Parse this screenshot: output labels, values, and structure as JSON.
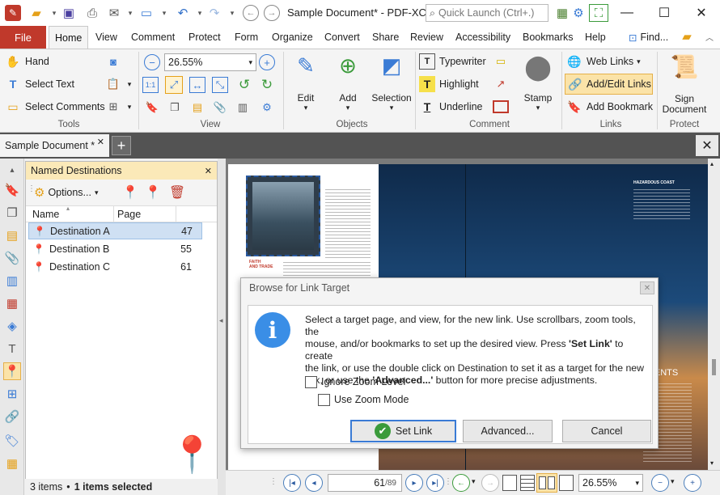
{
  "window": {
    "title": "Sample Document* - PDF-XCh...",
    "quick_launch_placeholder": "Quick Launch (Ctrl+.)"
  },
  "ribbon_tabs": [
    "File",
    "Home",
    "View",
    "Comment",
    "Protect",
    "Form",
    "Organize",
    "Convert",
    "Share",
    "Review",
    "Accessibility",
    "Bookmarks",
    "Help"
  ],
  "find_label": "Find...",
  "tools_group": {
    "hand": "Hand",
    "select_text": "Select Text",
    "select_comments": "Select Comments",
    "label": "Tools"
  },
  "view_group": {
    "zoom": "26.55%",
    "label": "View"
  },
  "objects_group": {
    "edit": "Edit",
    "add": "Add",
    "selection": "Selection",
    "label": "Objects"
  },
  "comment_group": {
    "typewriter": "Typewriter",
    "highlight": "Highlight",
    "underline": "Underline",
    "stamp": "Stamp",
    "label": "Comment"
  },
  "links_group": {
    "web_links": "Web Links",
    "add_edit_links": "Add/Edit Links",
    "add_bookmark": "Add Bookmark",
    "label": "Links"
  },
  "protect_group": {
    "sign_document_line1": "Sign",
    "sign_document_line2": "Document",
    "label": "Protect"
  },
  "doc_tab": "Sample Document *",
  "panel": {
    "title": "Named Destinations",
    "options": "Options...",
    "col_name": "Name",
    "col_page": "Page",
    "rows": [
      {
        "name": "Destination A",
        "page": "47"
      },
      {
        "name": "Destination B",
        "page": "55"
      },
      {
        "name": "Destination C",
        "page": "61"
      }
    ],
    "status_items": "3 items",
    "status_selected": "1 items selected"
  },
  "page_text": {
    "article_heading": "HAZARDOUS COAST",
    "faith_line1": "FAITH",
    "faith_line2": "AND TRADE",
    "right_heading": "DCENTS"
  },
  "dialog": {
    "title": "Browse for Link Target",
    "msg_line1": "Select a target page, and view, for the new link. Use scrollbars, zoom tools, the",
    "msg_line2_pre": "mouse, and/or bookmarks to set up the desired view. Press ",
    "msg_line2_bold": "'Set Link'",
    "msg_line2_post": " to create",
    "msg_line3": "the link, or use the double click on Destination to set it as a target for the new",
    "msg_line4_pre": "link, or use the ",
    "msg_line4_bold": "'Advanced...'",
    "msg_line4_post": " button for more precise adjustments.",
    "ignore_zoom": "Ignore Zoom Level",
    "use_zoom_mode": "Use Zoom Mode",
    "set_link": "Set Link",
    "advanced": "Advanced...",
    "cancel": "Cancel"
  },
  "navigation": {
    "page_current": "61",
    "page_total": "/89",
    "zoom": "26.55%"
  }
}
